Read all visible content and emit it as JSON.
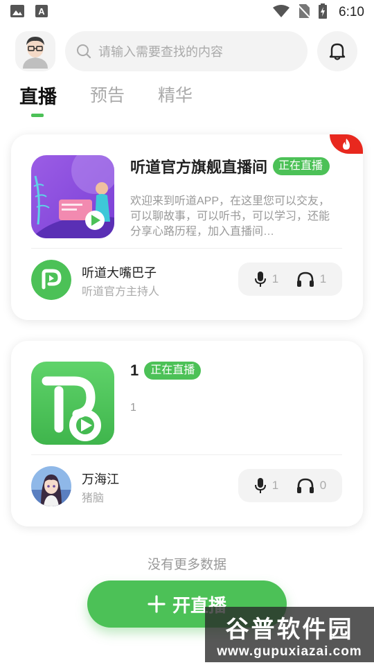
{
  "status_bar": {
    "time": "6:10"
  },
  "header": {
    "search_placeholder": "请输入需要查找的内容"
  },
  "tabs": [
    {
      "label": "直播",
      "active": true
    },
    {
      "label": "预告",
      "active": false
    },
    {
      "label": "精华",
      "active": false
    }
  ],
  "rooms": [
    {
      "title": "听道官方旗舰直播间",
      "badge": "正在直播",
      "description": "欢迎来到听道APP，在这里您可以交友，可以聊故事，可以听书，可以学习，还能分享心路历程，加入直播间…",
      "host_name": "听道大嘴巴子",
      "host_title": "听道官方主持人",
      "speakers": "1",
      "listeners": "1",
      "hot": true
    },
    {
      "title": "1",
      "badge": "正在直播",
      "description": "1",
      "host_name": "万海江",
      "host_title": "猪脑",
      "speakers": "1",
      "listeners": "0",
      "hot": false
    }
  ],
  "no_more_text": "没有更多数据",
  "start_live_button": "开直播",
  "watermark": {
    "title": "谷普软件园",
    "url": "www.gupuxiazai.com"
  },
  "colors": {
    "accent": "#4cc157",
    "hot": "#e8281e"
  }
}
